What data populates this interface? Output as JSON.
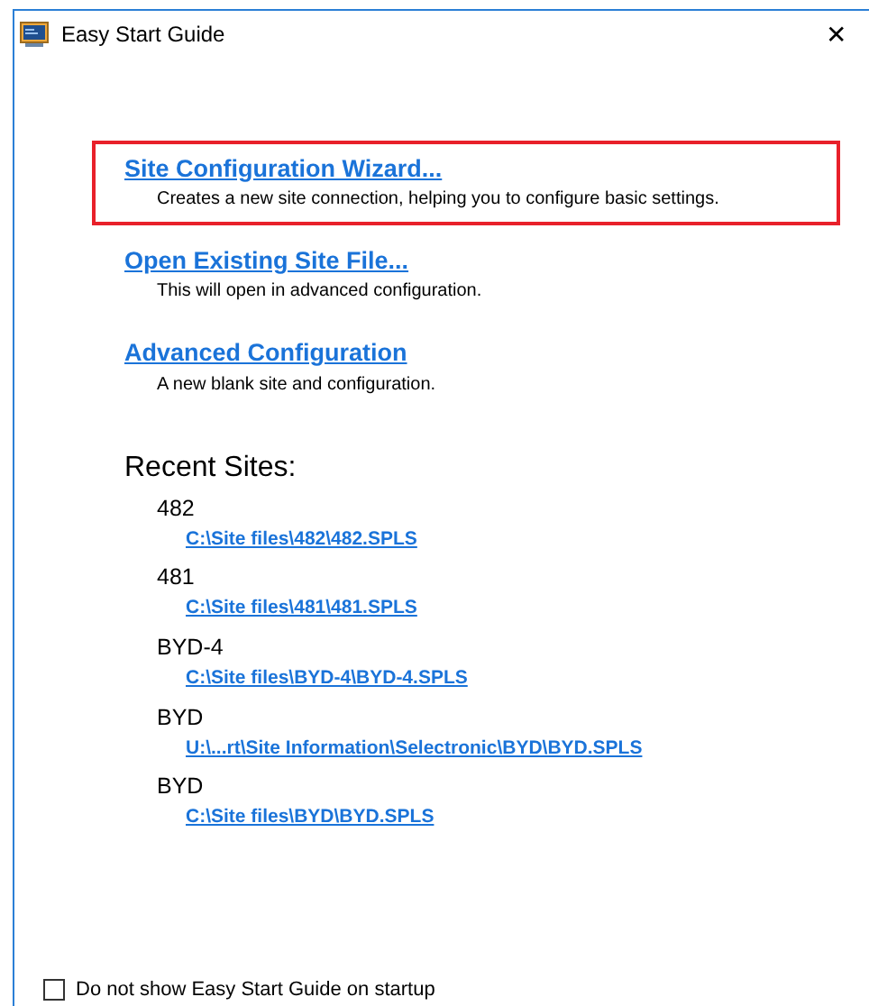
{
  "window": {
    "title": "Easy Start Guide",
    "close": "✕"
  },
  "actions": [
    {
      "label": "Site Configuration Wizard...",
      "description": "Creates a new site connection, helping you to configure basic settings.",
      "highlighted": true
    },
    {
      "label": "Open Existing Site File...",
      "description": "This will open in advanced configuration.",
      "highlighted": false
    },
    {
      "label": "Advanced Configuration",
      "description": "A new blank site and configuration.",
      "highlighted": false
    }
  ],
  "recent_sites": {
    "heading": "Recent Sites:",
    "items": [
      {
        "name": "482",
        "path": "C:\\Site files\\482\\482.SPLS"
      },
      {
        "name": "481",
        "path": "C:\\Site files\\481\\481.SPLS"
      },
      {
        "name": "BYD-4",
        "path": "C:\\Site files\\BYD-4\\BYD-4.SPLS"
      },
      {
        "name": "BYD",
        "path": "U:\\...rt\\Site Information\\Selectronic\\BYD\\BYD.SPLS"
      },
      {
        "name": "BYD",
        "path": "C:\\Site files\\BYD\\BYD.SPLS"
      }
    ]
  },
  "startup_checkbox": {
    "label": "Do not show Easy Start Guide on startup",
    "checked": false
  }
}
